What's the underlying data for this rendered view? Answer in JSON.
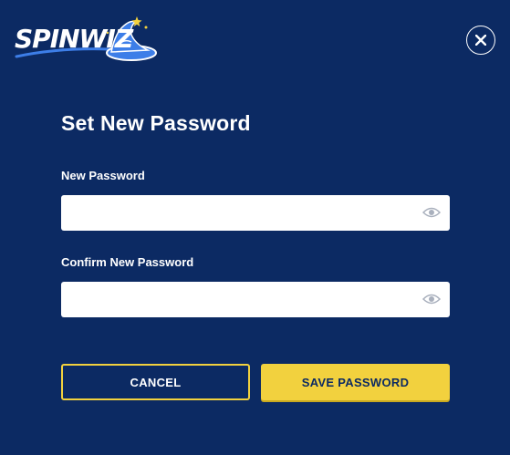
{
  "brand": {
    "name": "SPINWIZ"
  },
  "header": {
    "close_icon": "close-icon"
  },
  "form": {
    "title": "Set New Password",
    "new_password": {
      "label": "New Password",
      "value": "",
      "placeholder": "",
      "toggle_icon": "eye-icon"
    },
    "confirm_password": {
      "label": "Confirm New Password",
      "value": "",
      "placeholder": "",
      "toggle_icon": "eye-icon"
    },
    "cancel_label": "CANCEL",
    "save_label": "SAVE PASSWORD"
  },
  "colors": {
    "background": "#0c2a63",
    "accent": "#f2d13e",
    "hat": "#3d7ee8",
    "text": "#ffffff"
  }
}
